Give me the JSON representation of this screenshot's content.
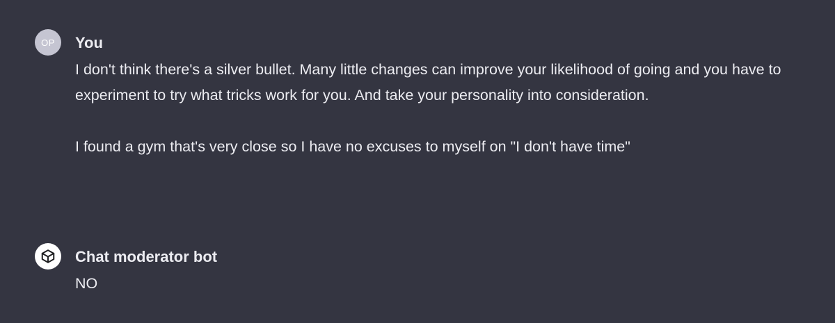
{
  "conversation": [
    {
      "avatar_text": "OP",
      "avatar_icon": "initials-avatar",
      "author": "You",
      "paragraphs": [
        "I don't think there's a silver bullet. Many little changes can improve your likelihood of going and you have to experiment to try what tricks work for you. And take your personality into consideration.",
        "I found a gym that's very close so I have no excuses to myself on \"I don't have time\""
      ]
    },
    {
      "avatar_icon": "cube-icon",
      "author": "Chat moderator bot",
      "paragraphs": [
        "NO"
      ]
    }
  ],
  "colors": {
    "background": "#343541",
    "text": "#ececf1",
    "user_avatar": "#c5c5d2",
    "bot_avatar": "#ffffff"
  }
}
